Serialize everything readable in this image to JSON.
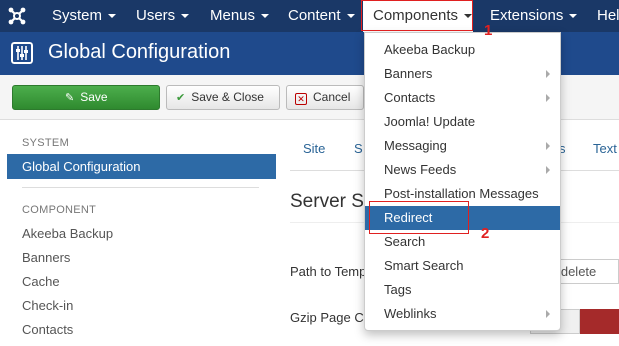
{
  "topnav": {
    "items": [
      {
        "label": "System"
      },
      {
        "label": "Users"
      },
      {
        "label": "Menus"
      },
      {
        "label": "Content"
      },
      {
        "label": "Components"
      },
      {
        "label": "Extensions"
      },
      {
        "label": "Hel"
      }
    ]
  },
  "annotations": {
    "one": "1",
    "two": "2"
  },
  "titlebar": {
    "title": "Global Configuration"
  },
  "toolbar": {
    "save": "Save",
    "save_close": "Save & Close",
    "cancel": "Cancel"
  },
  "sidebar": {
    "system_head": "SYSTEM",
    "active": "Global Configuration",
    "component_head": "COMPONENT",
    "items": [
      "Akeeba Backup",
      "Banners",
      "Cache",
      "Check-in",
      "Contacts"
    ]
  },
  "main": {
    "tabs": [
      "Site",
      "S",
      "s",
      "Text"
    ],
    "heading": "Server S",
    "fields": [
      {
        "label": "Path to Temp",
        "value": "ocs\\delete"
      },
      {
        "label": "Gzip Page C"
      }
    ]
  },
  "dropdown": {
    "items": [
      {
        "label": "Akeeba Backup",
        "submenu": false
      },
      {
        "label": "Banners",
        "submenu": true
      },
      {
        "label": "Contacts",
        "submenu": true
      },
      {
        "label": "Joomla! Update",
        "submenu": false
      },
      {
        "label": "Messaging",
        "submenu": true
      },
      {
        "label": "News Feeds",
        "submenu": true
      },
      {
        "label": "Post-installation Messages",
        "submenu": false
      },
      {
        "label": "Redirect",
        "submenu": false,
        "highlighted": true
      },
      {
        "label": "Search",
        "submenu": false
      },
      {
        "label": "Smart Search",
        "submenu": false
      },
      {
        "label": "Tags",
        "submenu": false
      },
      {
        "label": "Weblinks",
        "submenu": true
      }
    ]
  },
  "colors": {
    "nav_bg": "#1a3867",
    "title_bg": "#1f4a8c",
    "highlight": "#2d6aa6",
    "save_green": "#3c9a3c",
    "annotation_red": "#e02020"
  }
}
